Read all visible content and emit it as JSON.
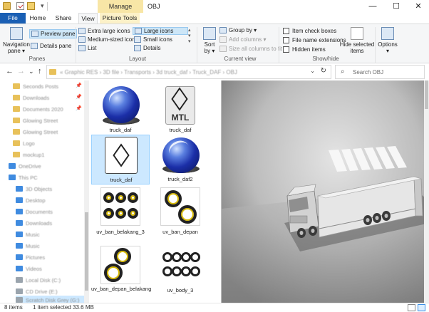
{
  "window": {
    "title": "OBJ",
    "manage_tab": "Manage",
    "minimize": "—",
    "maximize": "☐",
    "close": "✕"
  },
  "quick_access": {
    "dropdown": "▾"
  },
  "tabs": {
    "file": "File",
    "home": "Home",
    "share": "Share",
    "view": "View",
    "picture_tools": "Picture Tools"
  },
  "ribbon": {
    "panes": {
      "label": "Panes",
      "navigation_pane": "Navigation",
      "navigation_pane_2": "pane ▾",
      "preview_pane": "Preview pane",
      "details_pane": "Details pane"
    },
    "layout": {
      "label": "Layout",
      "extra_large_icons": "Extra large icons",
      "large_icons": "Large icons",
      "medium_sized_icons": "Medium-sized icons",
      "small_icons": "Small icons",
      "list": "List",
      "details": "Details"
    },
    "current_view": {
      "label": "Current view",
      "sort": "Sort",
      "sort_2": "by ▾",
      "group_by": "Group by ▾",
      "add_columns": "Add columns ▾",
      "size_all_columns": "Size all columns to fit"
    },
    "show_hide": {
      "label": "Show/hide",
      "item_check_boxes": "Item check boxes",
      "file_name_extensions": "File name extensions",
      "hidden_items": "Hidden items",
      "hide_selected": "Hide selected",
      "hide_selected_2": "items"
    },
    "options": "Options",
    "options_2": "▾"
  },
  "address": {
    "back": "←",
    "forward": "→",
    "recent": "⌄",
    "up": "↑",
    "path": "« Graphic RES › 3D file › Transports › 3d truck_daf › Truck_DAF › OBJ",
    "dropdown": "⌄",
    "refresh": "↻"
  },
  "search": {
    "icon": "⌕",
    "placeholder": "Search OBJ"
  },
  "nav_pane": {
    "items": [
      {
        "label": "Seconds Posts",
        "icon": "folder",
        "pinned": true
      },
      {
        "label": "Downloads",
        "icon": "folder",
        "pinned": true
      },
      {
        "label": "Documents 2020",
        "icon": "folder",
        "pinned": true
      },
      {
        "label": "Glowing Street",
        "icon": "folder",
        "pinned": false
      },
      {
        "label": "Glowing Street",
        "icon": "folder",
        "pinned": false
      },
      {
        "label": "Logo",
        "icon": "folder",
        "pinned": false
      },
      {
        "label": "mockup1",
        "icon": "folder",
        "pinned": false
      },
      {
        "label": "OneDrive",
        "icon": "cloud",
        "pinned": false
      },
      {
        "label": "This PC",
        "icon": "pc",
        "pinned": false
      },
      {
        "label": "3D Objects",
        "icon": "blue",
        "pinned": false
      },
      {
        "label": "Desktop",
        "icon": "blue",
        "pinned": false
      },
      {
        "label": "Documents",
        "icon": "blue",
        "pinned": false
      },
      {
        "label": "Downloads",
        "icon": "blue",
        "pinned": false
      },
      {
        "label": "Music",
        "icon": "blue",
        "pinned": false
      },
      {
        "label": "Music",
        "icon": "blue",
        "pinned": false
      },
      {
        "label": "Pictures",
        "icon": "blue",
        "pinned": false
      },
      {
        "label": "Videos",
        "icon": "blue",
        "pinned": false
      },
      {
        "label": "Local Disk (C:)",
        "icon": "drive",
        "pinned": false
      },
      {
        "label": "CD Drive (E:)",
        "icon": "drive",
        "pinned": false
      },
      {
        "label": "Scratch Disk Grey (G:)",
        "icon": "drive",
        "pinned": false
      }
    ],
    "pin_glyph": "📌"
  },
  "files": [
    {
      "name": "truck_daf",
      "type": "c4d"
    },
    {
      "name": "truck_daf",
      "type": "mtl",
      "icon_text": "MTL"
    },
    {
      "name": "truck_daf",
      "type": "obj",
      "selected": true
    },
    {
      "name": "truck_daf2",
      "type": "c4d"
    },
    {
      "name": "uv_ban_belakang_3",
      "type": "texture"
    },
    {
      "name": "uv_ban_depan",
      "type": "texture"
    },
    {
      "name": "uv_ban_depan_belakang",
      "type": "texture"
    },
    {
      "name": "uv_body_3",
      "type": "texture"
    }
  ],
  "status": {
    "items": "8 items",
    "selected": "1 item selected  33.6 MB"
  }
}
